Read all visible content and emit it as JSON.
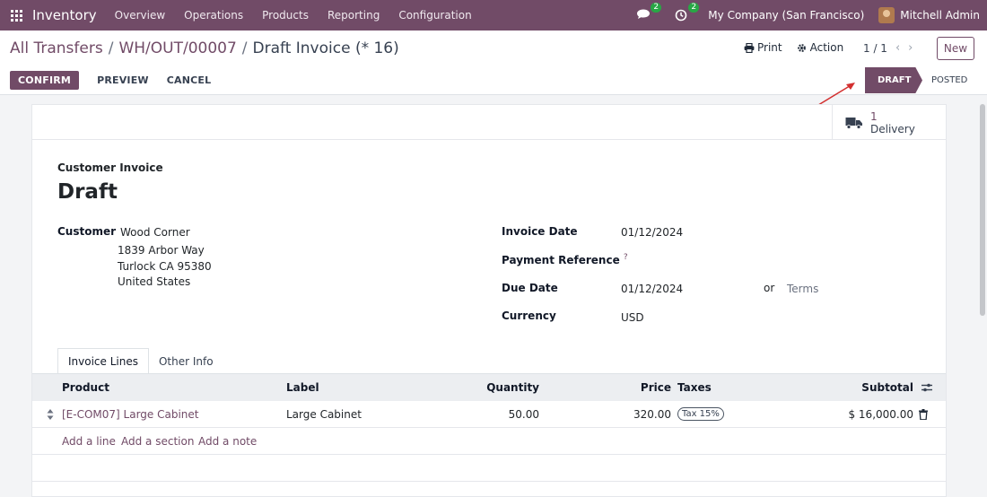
{
  "navbar": {
    "app_name": "Inventory",
    "menu": [
      "Overview",
      "Operations",
      "Products",
      "Reporting",
      "Configuration"
    ],
    "messages_count": "2",
    "activities_count": "2",
    "company": "My Company (San Francisco)",
    "user": "Mitchell Admin"
  },
  "breadcrumb": {
    "items": [
      "All Transfers",
      "WH/OUT/00007"
    ],
    "current": "Draft Invoice (* 16)",
    "separator": "/"
  },
  "toolbar": {
    "print_label": "Print",
    "action_label": "Action",
    "pager": "1 / 1",
    "new_label": "New"
  },
  "buttons": {
    "confirm": "CONFIRM",
    "preview": "PREVIEW",
    "cancel": "CANCEL"
  },
  "status": {
    "active": "DRAFT",
    "next": "POSTED"
  },
  "smart_buttons": {
    "delivery_count": "1",
    "delivery_label": "Delivery"
  },
  "document": {
    "type": "Customer Invoice",
    "name": "Draft"
  },
  "fields": {
    "customer_label": "Customer",
    "customer_name": "Wood Corner",
    "address_line1": "1839 Arbor Way",
    "address_line2": "Turlock CA 95380",
    "address_line3": "United States",
    "invoice_date_label": "Invoice Date",
    "invoice_date": "01/12/2024",
    "payment_reference_label": "Payment Reference",
    "payment_reference_help": "?",
    "due_date_label": "Due Date",
    "due_date": "01/12/2024",
    "or_label": "or",
    "terms_placeholder": "Terms",
    "currency_label": "Currency",
    "currency": "USD"
  },
  "tabs": [
    "Invoice Lines",
    "Other Info"
  ],
  "lines": {
    "headers": {
      "product": "Product",
      "label": "Label",
      "quantity": "Quantity",
      "price": "Price",
      "taxes": "Taxes",
      "subtotal": "Subtotal"
    },
    "rows": [
      {
        "product": "[E-COM07] Large Cabinet",
        "label": "Large Cabinet",
        "quantity": "50.00",
        "price": "320.00",
        "taxes": "Tax 15%",
        "subtotal": "$ 16,000.00"
      }
    ],
    "add_line": "Add a line",
    "add_section": "Add a section",
    "add_note": "Add a note"
  },
  "colors": {
    "brand": "#714b67",
    "annotation_arrow": "#d32f2f"
  }
}
